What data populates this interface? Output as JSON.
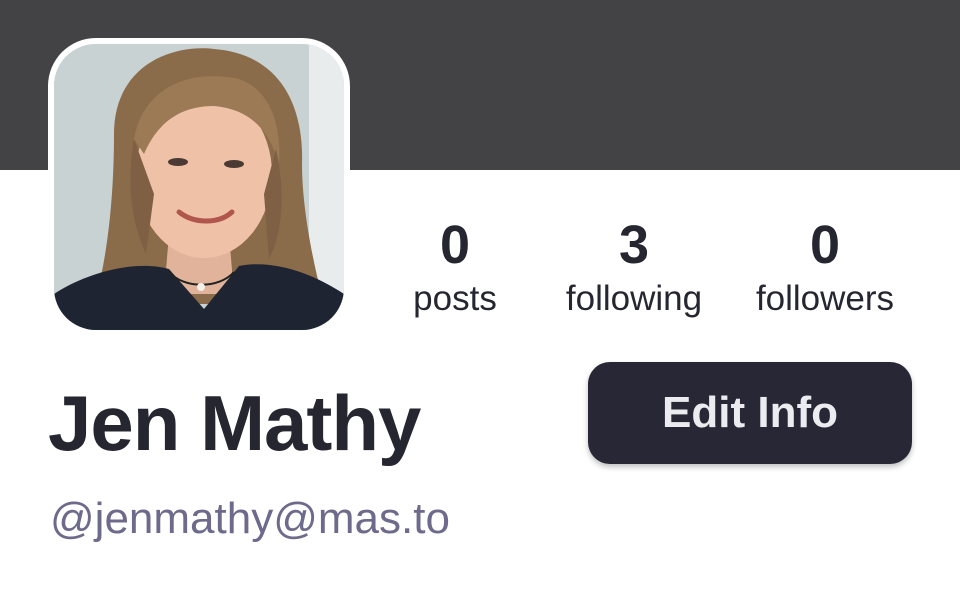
{
  "profile": {
    "display_name": "Jen Mathy",
    "handle": "@jenmathy@mas.to",
    "avatar_alt": "Profile photo of Jen Mathy"
  },
  "stats": {
    "posts": {
      "count": "0",
      "label": "posts"
    },
    "following": {
      "count": "3",
      "label": "following"
    },
    "followers": {
      "count": "0",
      "label": "followers"
    }
  },
  "actions": {
    "edit_label": "Edit Info"
  },
  "colors": {
    "banner": "#434346",
    "text_primary": "#262631",
    "handle": "#6e6a8b",
    "button_bg": "#282735",
    "button_text": "#ececf0"
  }
}
